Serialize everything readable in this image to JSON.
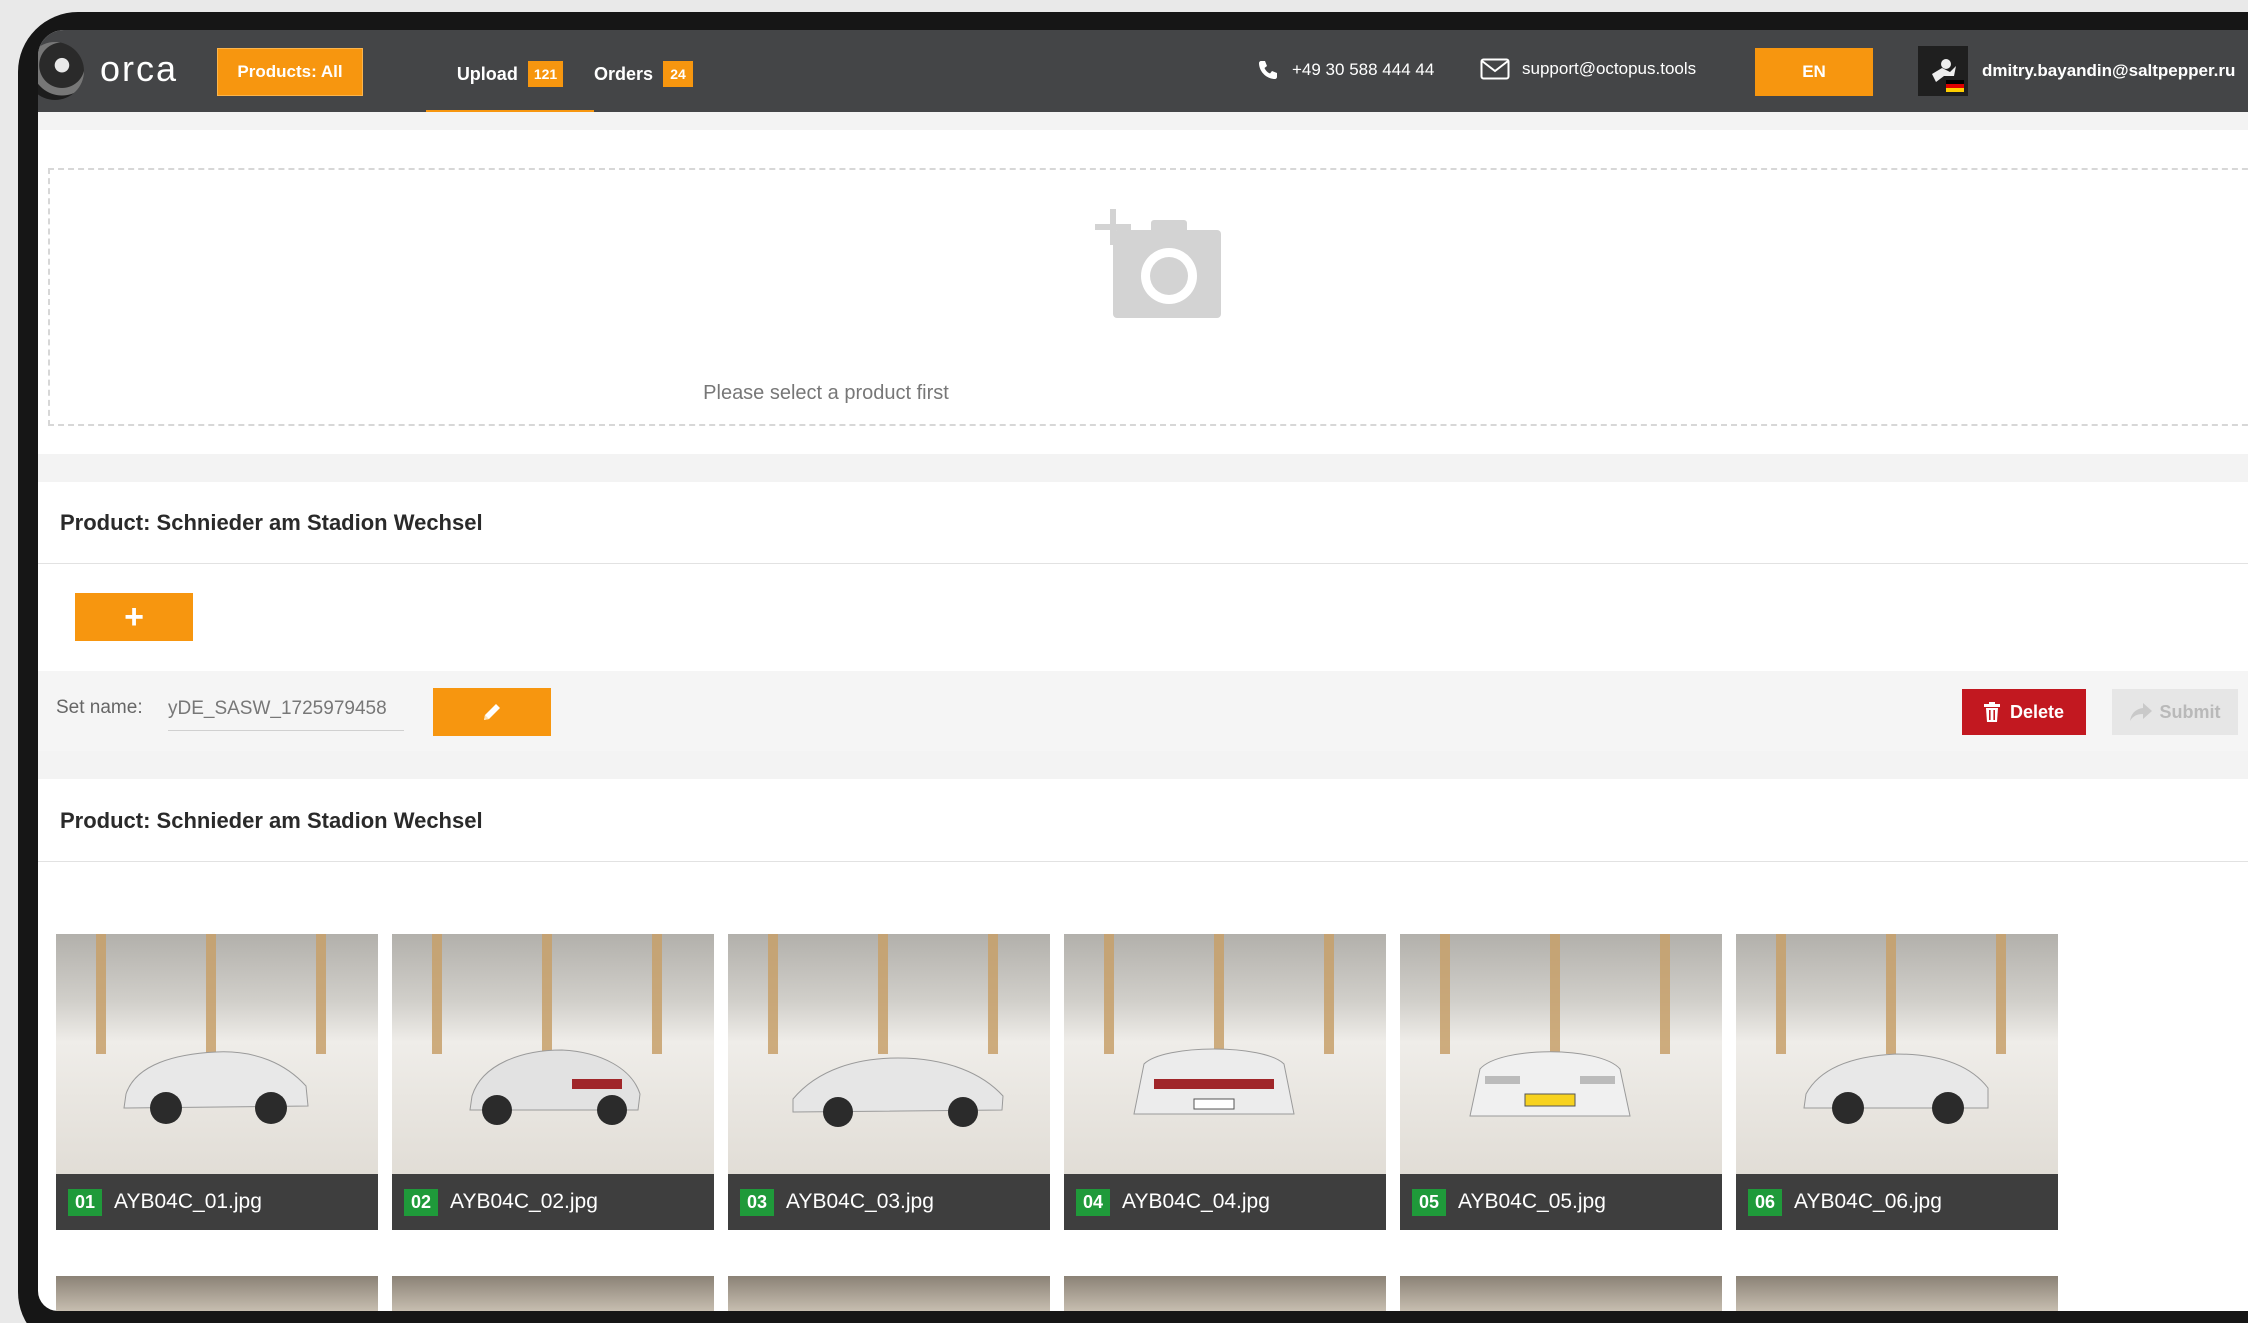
{
  "header": {
    "logo_text": "orca",
    "products_button": "Products: All",
    "tabs": [
      {
        "label": "Upload",
        "badge": "121",
        "active": true
      },
      {
        "label": "Orders",
        "badge": "24",
        "active": false
      }
    ],
    "phone": "+49 30 588 444 44",
    "email": "support@octopus.tools",
    "language": "EN",
    "user_email": "dmitry.bayandin@saltpepper.ru"
  },
  "dropzone": {
    "message": "Please select a product first"
  },
  "product_section": {
    "title": "Product: Schnieder am Stadion Wechsel",
    "add_button": "+"
  },
  "set": {
    "label": "Set name:",
    "value": "yDE_SASW_1725979458",
    "delete_label": "Delete",
    "submit_label": "Submit"
  },
  "gallery": {
    "title": "Product: Schnieder am Stadion Wechsel",
    "images": [
      {
        "num": "01",
        "name": "AYB04C_01.jpg"
      },
      {
        "num": "02",
        "name": "AYB04C_02.jpg"
      },
      {
        "num": "03",
        "name": "AYB04C_03.jpg"
      },
      {
        "num": "04",
        "name": "AYB04C_04.jpg"
      },
      {
        "num": "05",
        "name": "AYB04C_05.jpg"
      },
      {
        "num": "06",
        "name": "AYB04C_06.jpg"
      }
    ]
  },
  "colors": {
    "accent": "#f7960f",
    "topbar": "#444547",
    "danger": "#c21820",
    "badge_green": "#1f9a3a"
  },
  "icons": [
    "phone-icon",
    "mail-icon",
    "add-photo-icon",
    "pencil-icon",
    "trash-icon",
    "share-icon",
    "avatar-icon"
  ]
}
